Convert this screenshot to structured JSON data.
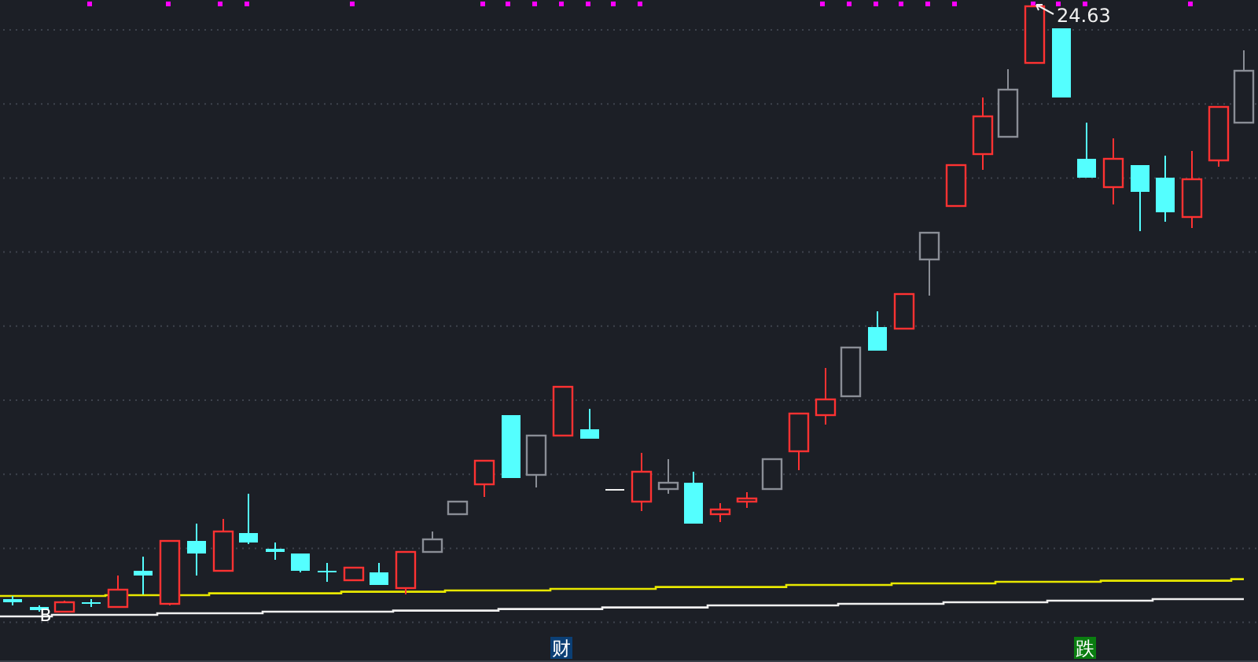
{
  "chart": {
    "high_label": {
      "text": "24.63"
    },
    "markers": [
      {
        "kind": "buy",
        "text": "B"
      },
      {
        "kind": "finance",
        "text": "财"
      },
      {
        "kind": "fall",
        "text": "跌"
      }
    ]
  }
}
